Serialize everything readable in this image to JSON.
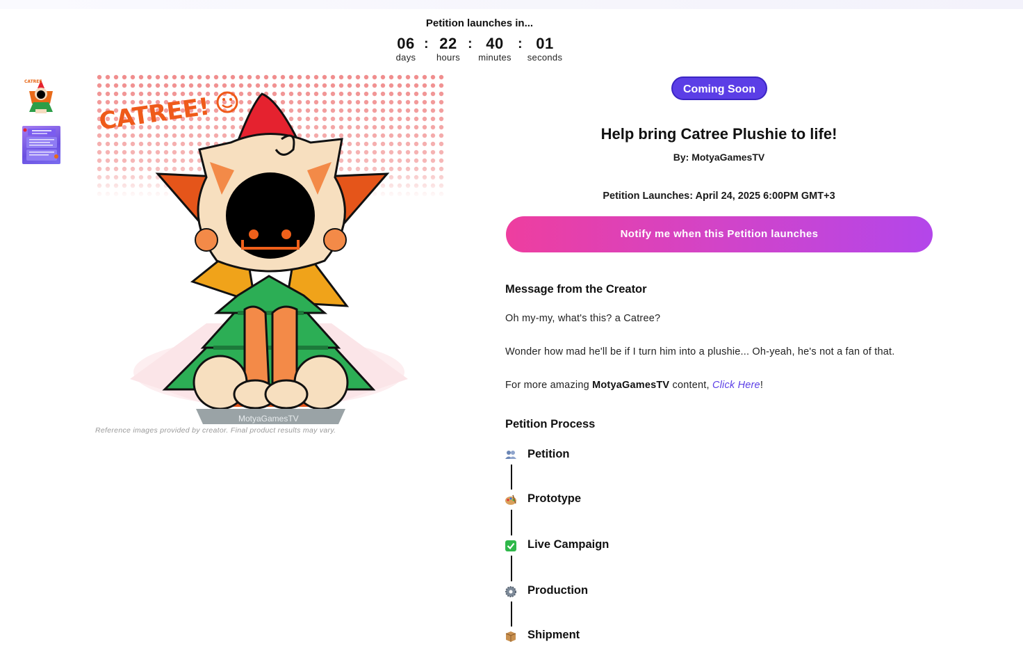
{
  "countdown": {
    "label": "Petition launches in...",
    "days": "06",
    "days_label": "days",
    "hours": "22",
    "hours_label": "hours",
    "minutes": "40",
    "minutes_label": "minutes",
    "seconds": "01",
    "seconds_label": "seconds",
    "separator": ":"
  },
  "gallery": {
    "thumbnails": [
      "catree-plushie-art",
      "petition-info-card"
    ],
    "watermark": "MotyaGamesTV",
    "logo_text": "CATREE!",
    "caption": "Reference images provided by creator. Final product results may vary."
  },
  "product": {
    "status_badge": "Coming Soon",
    "title": "Help bring Catree Plushie to life!",
    "byline": "By: MotyaGamesTV",
    "launch_date": "Petition Launches: April 24, 2025 6:00PM GMT+3",
    "notify_button": "Notify me when this Petition launches"
  },
  "creator_message": {
    "heading": "Message from the Creator",
    "p1": "Oh my-my, what's this? a Catree?",
    "p2": "Wonder how mad he'll be if I turn him into a plushie... Oh-yeah, he's not a fan of that.",
    "p3_prefix": "For more amazing ",
    "p3_bold": "MotyaGamesTV",
    "p3_middle": " content, ",
    "p3_link": "Click Here",
    "p3_suffix": "!"
  },
  "process": {
    "heading": "Petition Process",
    "steps": [
      {
        "label": "Petition",
        "icon": "people-icon"
      },
      {
        "label": "Prototype",
        "icon": "palette-icon"
      },
      {
        "label": "Live Campaign",
        "icon": "check-mark-icon"
      },
      {
        "label": "Production",
        "icon": "gear-icon"
      },
      {
        "label": "Shipment",
        "icon": "package-icon"
      }
    ]
  },
  "colors": {
    "accent": "#5b3ee6",
    "button_gradient_start": "#ee3e9f",
    "button_gradient_end": "#b346ea",
    "check_green": "#2fb84a"
  }
}
